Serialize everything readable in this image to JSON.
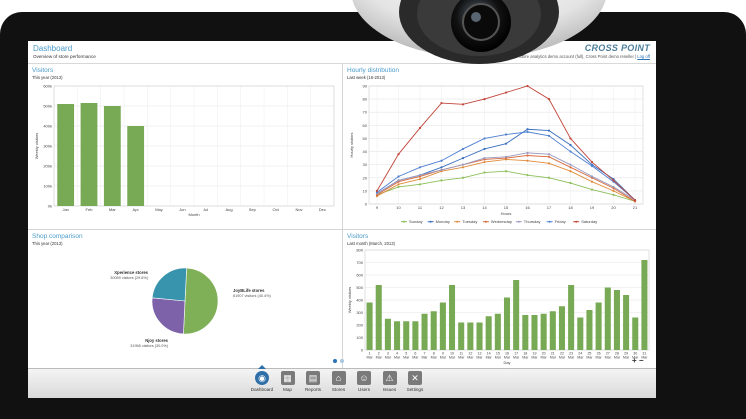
{
  "header": {
    "title": "Dashboard",
    "subtitle": "Overview of store performance",
    "brand": "CROSS POINT",
    "account_text": "Store analytics demo account (full), Cross Point demo reseller",
    "logoff_label": "Log off"
  },
  "panels": {
    "visitors_year": {
      "title": "Visitors",
      "subtitle": "This year (2013)"
    },
    "hourly": {
      "title": "Hourly distribution",
      "subtitle": "Last week (16-2013)"
    },
    "shop_comparison": {
      "title": "Shop comparison",
      "subtitle": "This year (2013)"
    },
    "visitors_month": {
      "title": "Visitors",
      "subtitle": "Last month (March, 2013)"
    }
  },
  "chart_data": [
    {
      "type": "bar",
      "title": "Visitors",
      "xlabel": "Month",
      "ylabel": "Weekly visitors",
      "categories": [
        "Jan",
        "Feb",
        "Mar",
        "Apr",
        "May",
        "Jun",
        "Jul",
        "Aug",
        "Sep",
        "Oct",
        "Nov",
        "Dec"
      ],
      "ytick_labels": [
        "0k",
        "100k",
        "200k",
        "300k",
        "400k",
        "500k",
        "600k"
      ],
      "ylim": [
        0,
        600
      ],
      "values": [
        510,
        515,
        500,
        400,
        null,
        null,
        null,
        null,
        null,
        null,
        null,
        null
      ],
      "color": "#78a955",
      "grid": true
    },
    {
      "type": "line",
      "title": "Hourly distribution",
      "xlabel": "Hours",
      "ylabel": "Hourly visitors",
      "x": [
        "9",
        "10",
        "11",
        "12",
        "13",
        "14",
        "15",
        "16",
        "17",
        "18",
        "19",
        "20",
        "21"
      ],
      "ytick_labels": [
        "0",
        "10",
        "20",
        "30",
        "40",
        "50",
        "60",
        "70",
        "80",
        "90"
      ],
      "ylim": [
        0,
        90
      ],
      "grid": true,
      "legend": "bottom",
      "series": [
        {
          "name": "Sunday",
          "color": "#8cbf5a",
          "values": [
            7,
            13,
            15,
            18,
            20,
            24,
            25,
            22,
            20,
            16,
            11,
            7,
            2
          ]
        },
        {
          "name": "Monday",
          "color": "#3a6fbf",
          "values": [
            8,
            18,
            22,
            28,
            35,
            42,
            46,
            57,
            56,
            45,
            30,
            19,
            3
          ]
        },
        {
          "name": "Tuesday",
          "color": "#e08b3a",
          "values": [
            6,
            15,
            19,
            25,
            28,
            32,
            34,
            33,
            31,
            25,
            17,
            10,
            2
          ]
        },
        {
          "name": "Wednesday",
          "color": "#d96a3c",
          "values": [
            7,
            17,
            21,
            26,
            30,
            34,
            35,
            37,
            36,
            28,
            20,
            12,
            2
          ]
        },
        {
          "name": "Thursday",
          "color": "#9a9ac0",
          "values": [
            8,
            18,
            22,
            26,
            30,
            35,
            36,
            39,
            38,
            30,
            21,
            13,
            3
          ]
        },
        {
          "name": "Friday",
          "color": "#4f7fd1",
          "values": [
            9,
            21,
            28,
            33,
            42,
            50,
            53,
            55,
            52,
            40,
            29,
            17,
            3
          ]
        },
        {
          "name": "Saturday",
          "color": "#c2453a",
          "values": [
            10,
            38,
            58,
            77,
            76,
            80,
            85,
            90,
            80,
            50,
            32,
            18,
            3
          ]
        }
      ]
    },
    {
      "type": "pie",
      "title": "Shop comparison",
      "slices": [
        {
          "name": "JoyBLife stores",
          "value": 61907,
          "label": "61907 visitors (40.4%)",
          "color": "#7faf57"
        },
        {
          "name": "Njoy stores",
          "value": 31958,
          "label": "31958 visitors (30.0%)",
          "color": "#7d62a9"
        },
        {
          "name": "Xperience stores",
          "value": 30059,
          "label": "30059 visitors (29.6%)",
          "color": "#3893ad"
        }
      ]
    },
    {
      "type": "bar",
      "title": "Visitors",
      "xlabel": "Day",
      "ylabel": "Weekly visitors",
      "categories": [
        "1 Mar",
        "2 Mar",
        "3 Mar",
        "4 Mar",
        "5 Mar",
        "6 Mar",
        "7 Mar",
        "8 Mar",
        "9 Mar",
        "10 Mar",
        "11 Mar",
        "12 Mar",
        "13 Mar",
        "14 Mar",
        "15 Mar",
        "16 Mar",
        "17 Mar",
        "18 Mar",
        "19 Mar",
        "20 Mar",
        "21 Mar",
        "22 Mar",
        "23 Mar",
        "24 Mar",
        "25 Mar",
        "26 Mar",
        "27 Mar",
        "28 Mar",
        "29 Mar",
        "30 Mar",
        "31 Mar"
      ],
      "ytick_labels": [
        "0",
        "100",
        "200",
        "300",
        "400",
        "500",
        "600",
        "700",
        "800"
      ],
      "ylim": [
        0,
        800
      ],
      "values": [
        380,
        520,
        250,
        230,
        230,
        230,
        290,
        310,
        380,
        520,
        220,
        220,
        220,
        270,
        290,
        420,
        560,
        280,
        280,
        290,
        310,
        350,
        520,
        260,
        320,
        380,
        500,
        480,
        440,
        260,
        720,
        40
      ],
      "color": "#78a955",
      "grid": true
    }
  ],
  "pagination": {
    "dots": 2,
    "active": 0
  },
  "zoom_controls": {
    "plus": "+",
    "minus": "−"
  },
  "toolbar": {
    "items": [
      {
        "label": "Dashboard",
        "icon": "dashboard-icon",
        "glyph": "◉",
        "active": true
      },
      {
        "label": "Map",
        "icon": "map-icon",
        "glyph": "▦",
        "active": false
      },
      {
        "label": "Reports",
        "icon": "reports-icon",
        "glyph": "▤",
        "active": false
      },
      {
        "label": "Stores",
        "icon": "stores-icon",
        "glyph": "⌂",
        "active": false
      },
      {
        "label": "Users",
        "icon": "users-icon",
        "glyph": "☺",
        "active": false
      },
      {
        "label": "Issues",
        "icon": "issues-icon",
        "glyph": "⚠",
        "active": false
      },
      {
        "label": "Settings",
        "icon": "settings-icon",
        "glyph": "✕",
        "active": false
      }
    ]
  },
  "colors": {
    "accent": "#4a9ac9",
    "bar": "#78a955",
    "toolbar_active": "#2f6fa8",
    "bezel": "#111111"
  }
}
